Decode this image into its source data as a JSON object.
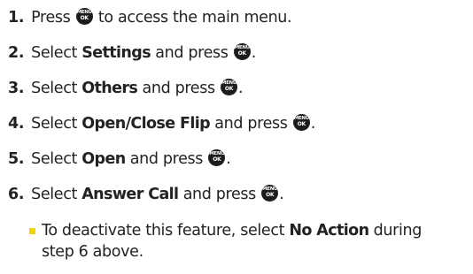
{
  "menu_key": {
    "line1": "MENU",
    "line2": "OK"
  },
  "steps": [
    {
      "number": "1.",
      "before": "Press",
      "bold": "",
      "after": "to access the main menu.",
      "end": ""
    },
    {
      "number": "2.",
      "before": "Select",
      "bold": "Settings",
      "after": "and press",
      "end": "."
    },
    {
      "number": "3.",
      "before": "Select",
      "bold": "Others",
      "after": "and press",
      "end": "."
    },
    {
      "number": "4.",
      "before": "Select",
      "bold": "Open/Close Flip",
      "after": "and press",
      "end": "."
    },
    {
      "number": "5.",
      "before": "Select",
      "bold": "Open",
      "after": "and press",
      "end": "."
    },
    {
      "number": "6.",
      "before": "Select",
      "bold": "Answer Call",
      "after": "and press",
      "end": "."
    }
  ],
  "note": {
    "before": "To deactivate this feature, select",
    "bold": "No Action",
    "after": "during step 6 above.",
    "bullet_color": "#f7d300"
  }
}
